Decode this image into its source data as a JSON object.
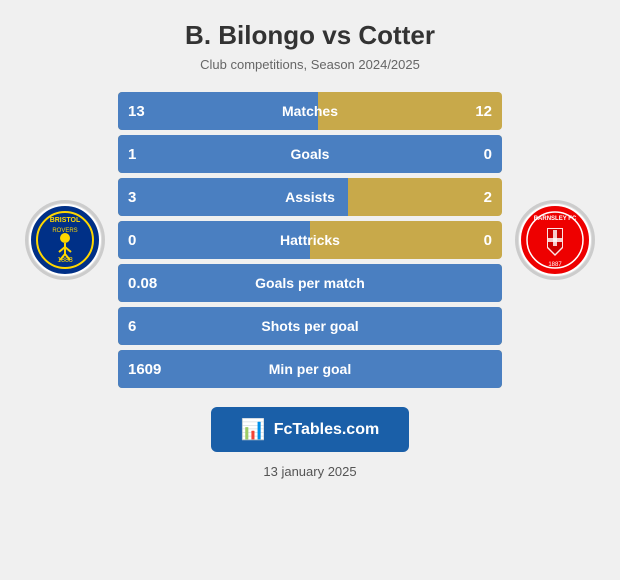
{
  "header": {
    "title": "B. Bilongo vs Cotter",
    "subtitle": "Club competitions, Season 2024/2025"
  },
  "stats": [
    {
      "id": "matches",
      "label": "Matches",
      "left_val": "13",
      "right_val": "12",
      "left_pct": 52,
      "has_right": true
    },
    {
      "id": "goals",
      "label": "Goals",
      "left_val": "1",
      "right_val": "0",
      "left_pct": 100,
      "has_right": true
    },
    {
      "id": "assists",
      "label": "Assists",
      "left_val": "3",
      "right_val": "2",
      "left_pct": 60,
      "has_right": true
    },
    {
      "id": "hattricks",
      "label": "Hattricks",
      "left_val": "0",
      "right_val": "0",
      "left_pct": 50,
      "has_right": true
    },
    {
      "id": "goals_per_match",
      "label": "Goals per match",
      "left_val": "0.08",
      "right_val": "",
      "left_pct": 100,
      "has_right": false
    },
    {
      "id": "shots_per_goal",
      "label": "Shots per goal",
      "left_val": "6",
      "right_val": "",
      "left_pct": 100,
      "has_right": false
    },
    {
      "id": "min_per_goal",
      "label": "Min per goal",
      "left_val": "1609",
      "right_val": "",
      "left_pct": 100,
      "has_right": false
    }
  ],
  "fctables": {
    "text": "FcTables.com"
  },
  "footer": {
    "date": "13 january 2025"
  }
}
